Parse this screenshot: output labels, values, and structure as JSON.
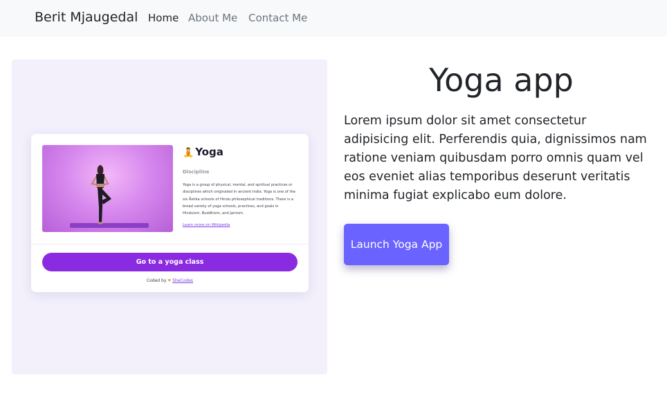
{
  "navbar": {
    "brand": "Berit Mjaugedal",
    "items": [
      {
        "label": "Home"
      },
      {
        "label": "About Me"
      },
      {
        "label": "Contact Me"
      }
    ]
  },
  "preview": {
    "title_emoji": "🧘",
    "title": "Yoga",
    "subtitle": "Discipline",
    "description": "Yoga is a group of physical, mental, and spiritual practices or disciplines which originated in ancient India. Yoga is one of the six Āstika schools of Hindu philosophical traditions. There is a broad variety of yoga schools, practices, and goals in Hinduism, Buddhism, and Jainism.",
    "link": "Learn more on Wikipedia",
    "button": "Go to a yoga class",
    "footer_prefix": "Coded by",
    "footer_emoji": "❤",
    "footer_link": "SheCodes"
  },
  "main": {
    "title": "Yoga app",
    "text": "Lorem ipsum dolor sit amet consectetur adipisicing elit. Perferendis quia, dignissimos nam ratione veniam quibusdam porro omnis quam vel eos eveniet alias temporibus deserunt veritatis minima fugiat explicabo eum dolore.",
    "button": "Launch Yoga App"
  },
  "colors": {
    "navbar_bg": "#f8f9fa",
    "panel_bg": "#f3f0fc",
    "card_button": "#8a2be2",
    "launch_button": "#6b63ff"
  }
}
